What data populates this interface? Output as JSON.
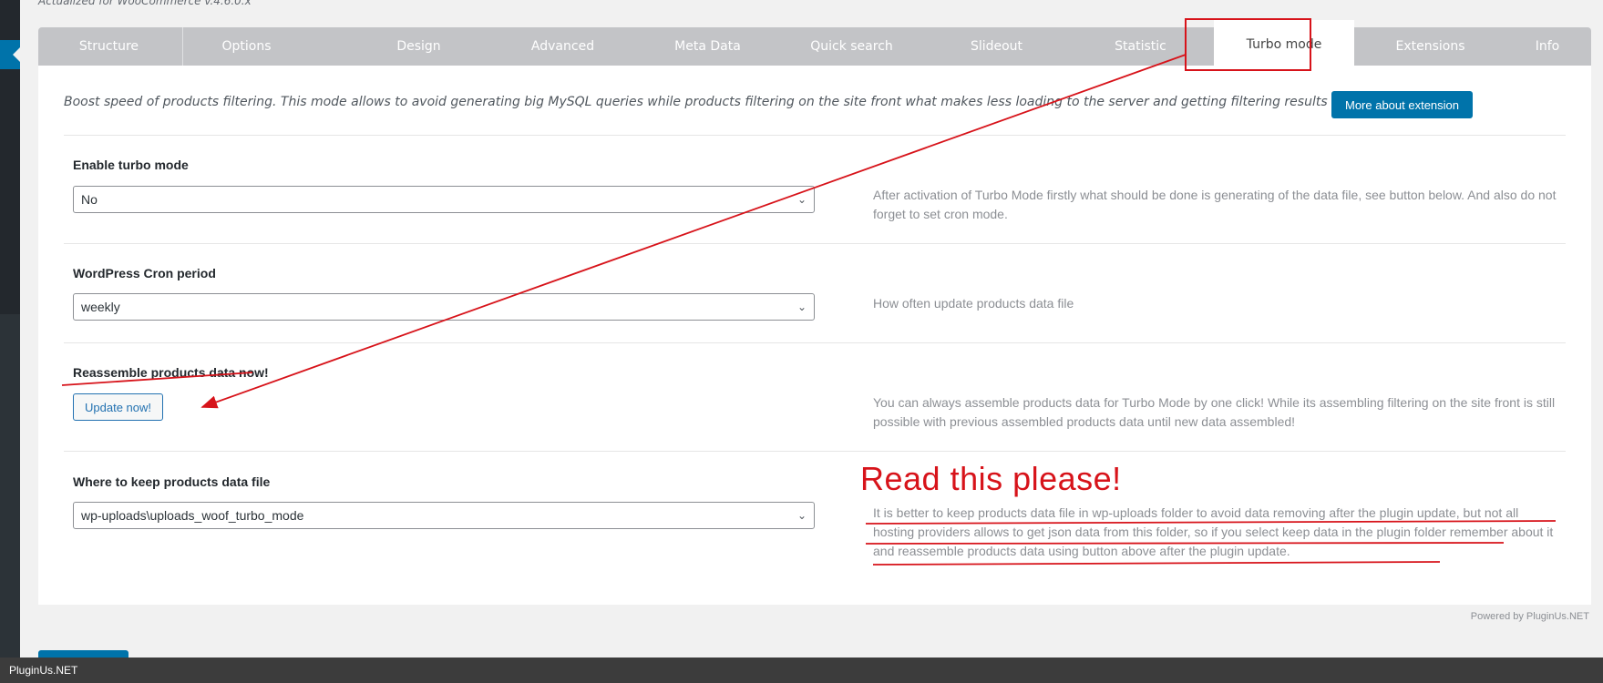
{
  "subtitle": "Actualized for WooCommerce v.4.6.0.x",
  "tabs": [
    {
      "label": "Structure"
    },
    {
      "label": "Options"
    },
    {
      "label": "Design"
    },
    {
      "label": "Advanced"
    },
    {
      "label": "Meta Data"
    },
    {
      "label": "Quick search"
    },
    {
      "label": "Slideout"
    },
    {
      "label": "Statistic"
    },
    {
      "label": "Turbo mode",
      "active": true
    },
    {
      "label": "Extensions"
    },
    {
      "label": "Info"
    }
  ],
  "intro": {
    "text": "Boost speed of products filtering. This mode allows to avoid generating big MySQL queries while products filtering on the site front what makes less loading to the server and getting filtering results more quick",
    "button": "More about extension"
  },
  "settings": {
    "enable_turbo": {
      "label": "Enable turbo mode",
      "value": "No",
      "description": "After activation of Turbo Mode firstly what should be done is generating of the data file, see button below. And also do not forget to set cron mode."
    },
    "cron_period": {
      "label": "WordPress Cron period",
      "value": "weekly",
      "description": "How often update products data file"
    },
    "reassemble": {
      "label": "Reassemble products data now!",
      "button": "Update now!",
      "description": "You can always assemble products data for Turbo Mode by one click! While its assembling filtering on the site front is still possible with previous assembled products data until new data assembled!"
    },
    "data_location": {
      "label": "Where to keep products data file",
      "value": "wp-uploads\\uploads_woof_turbo_mode",
      "description": "It is better to keep products data file in wp-uploads folder to avoid data removing after the plugin update, but not all hosting providers allows to get json data from this folder, so if you select keep data in the plugin folder remember about it and reassemble products data using button above after the plugin update."
    }
  },
  "annotation_note": "Read this  please!",
  "annotation_color": "#d7131a",
  "accent_color": "#0073aa",
  "powered_by": "Powered by PluginUs.NET",
  "footer": "PluginUs.NET"
}
